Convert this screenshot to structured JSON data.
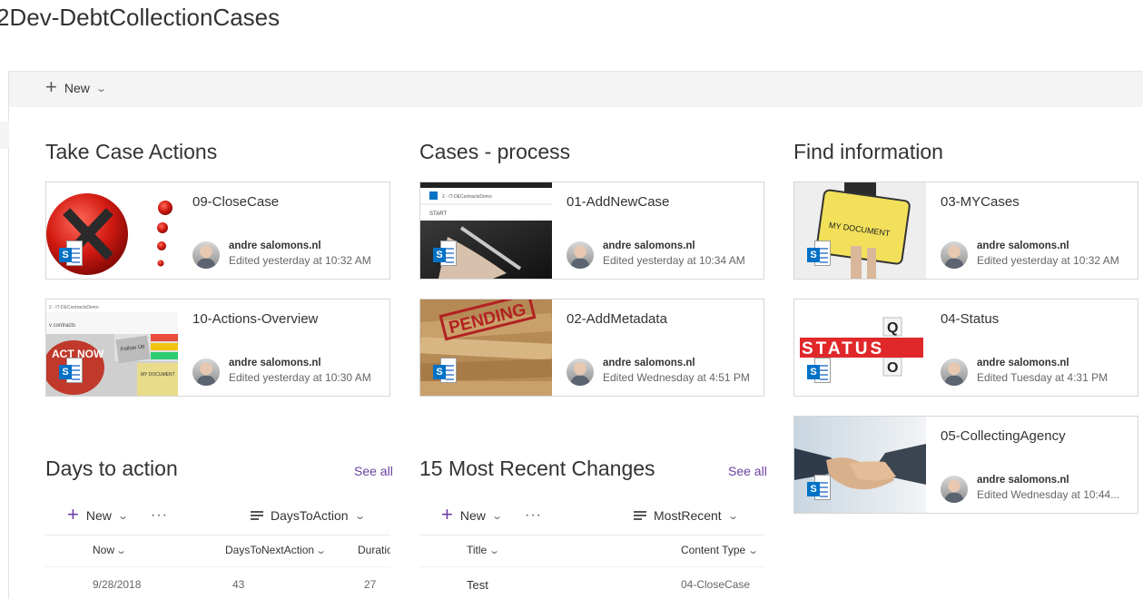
{
  "site": {
    "title": "2Dev-DebtCollectionCases"
  },
  "commandbar": {
    "new_label": "New"
  },
  "sections": {
    "take_case_actions": {
      "title": "Take Case Actions",
      "cards": [
        {
          "title": "09-CloseCase",
          "author": "andre salomons.nl",
          "edited": "Edited yesterday at 10:32 AM"
        },
        {
          "title": "10-Actions-Overview",
          "author": "andre salomons.nl",
          "edited": "Edited yesterday at 10:30 AM"
        }
      ]
    },
    "cases_process": {
      "title": "Cases - process",
      "cards": [
        {
          "title": "01-AddNewCase",
          "author": "andre salomons.nl",
          "edited": "Edited yesterday at 10:34 AM"
        },
        {
          "title": "02-AddMetadata",
          "author": "andre salomons.nl",
          "edited": "Edited Wednesday at 4:51 PM"
        }
      ]
    },
    "find_information": {
      "title": "Find information",
      "cards": [
        {
          "title": "03-MYCases",
          "author": "andre salomons.nl",
          "edited": "Edited yesterday at 10:32 AM"
        },
        {
          "title": "04-Status",
          "author": "andre salomons.nl",
          "edited": "Edited Tuesday at 4:31 PM"
        },
        {
          "title": "05-CollectingAgency",
          "author": "andre salomons.nl",
          "edited": "Edited Wednesday at 10:44..."
        }
      ]
    }
  },
  "thumb_text": {
    "start": "START",
    "demo": "2 - IT-DEContractsDemo",
    "contracts": "v contracts",
    "act_now": "ACT NOW",
    "follow_up": "Follow Up",
    "my_document": "MY DOCUMENT",
    "pending": "PENDING",
    "status": "STATUS"
  },
  "days_to_action": {
    "title": "Days to action",
    "see_all": "See all",
    "new_label": "New",
    "view_label": "DaysToAction",
    "columns": [
      "Now",
      "DaysToNextAction",
      "Duratio"
    ],
    "rows": [
      [
        "9/28/2018",
        "43",
        "27"
      ]
    ]
  },
  "recent_changes": {
    "title": "15 Most Recent Changes",
    "see_all": "See all",
    "new_label": "New",
    "view_label": "MostRecent",
    "columns": [
      "Title",
      "Content Type"
    ],
    "rows": [
      [
        "Test",
        "04-CloseCase"
      ]
    ]
  },
  "colors": {
    "accent": "#6b3fa0",
    "sharepoint_blue": "#0072c6"
  }
}
